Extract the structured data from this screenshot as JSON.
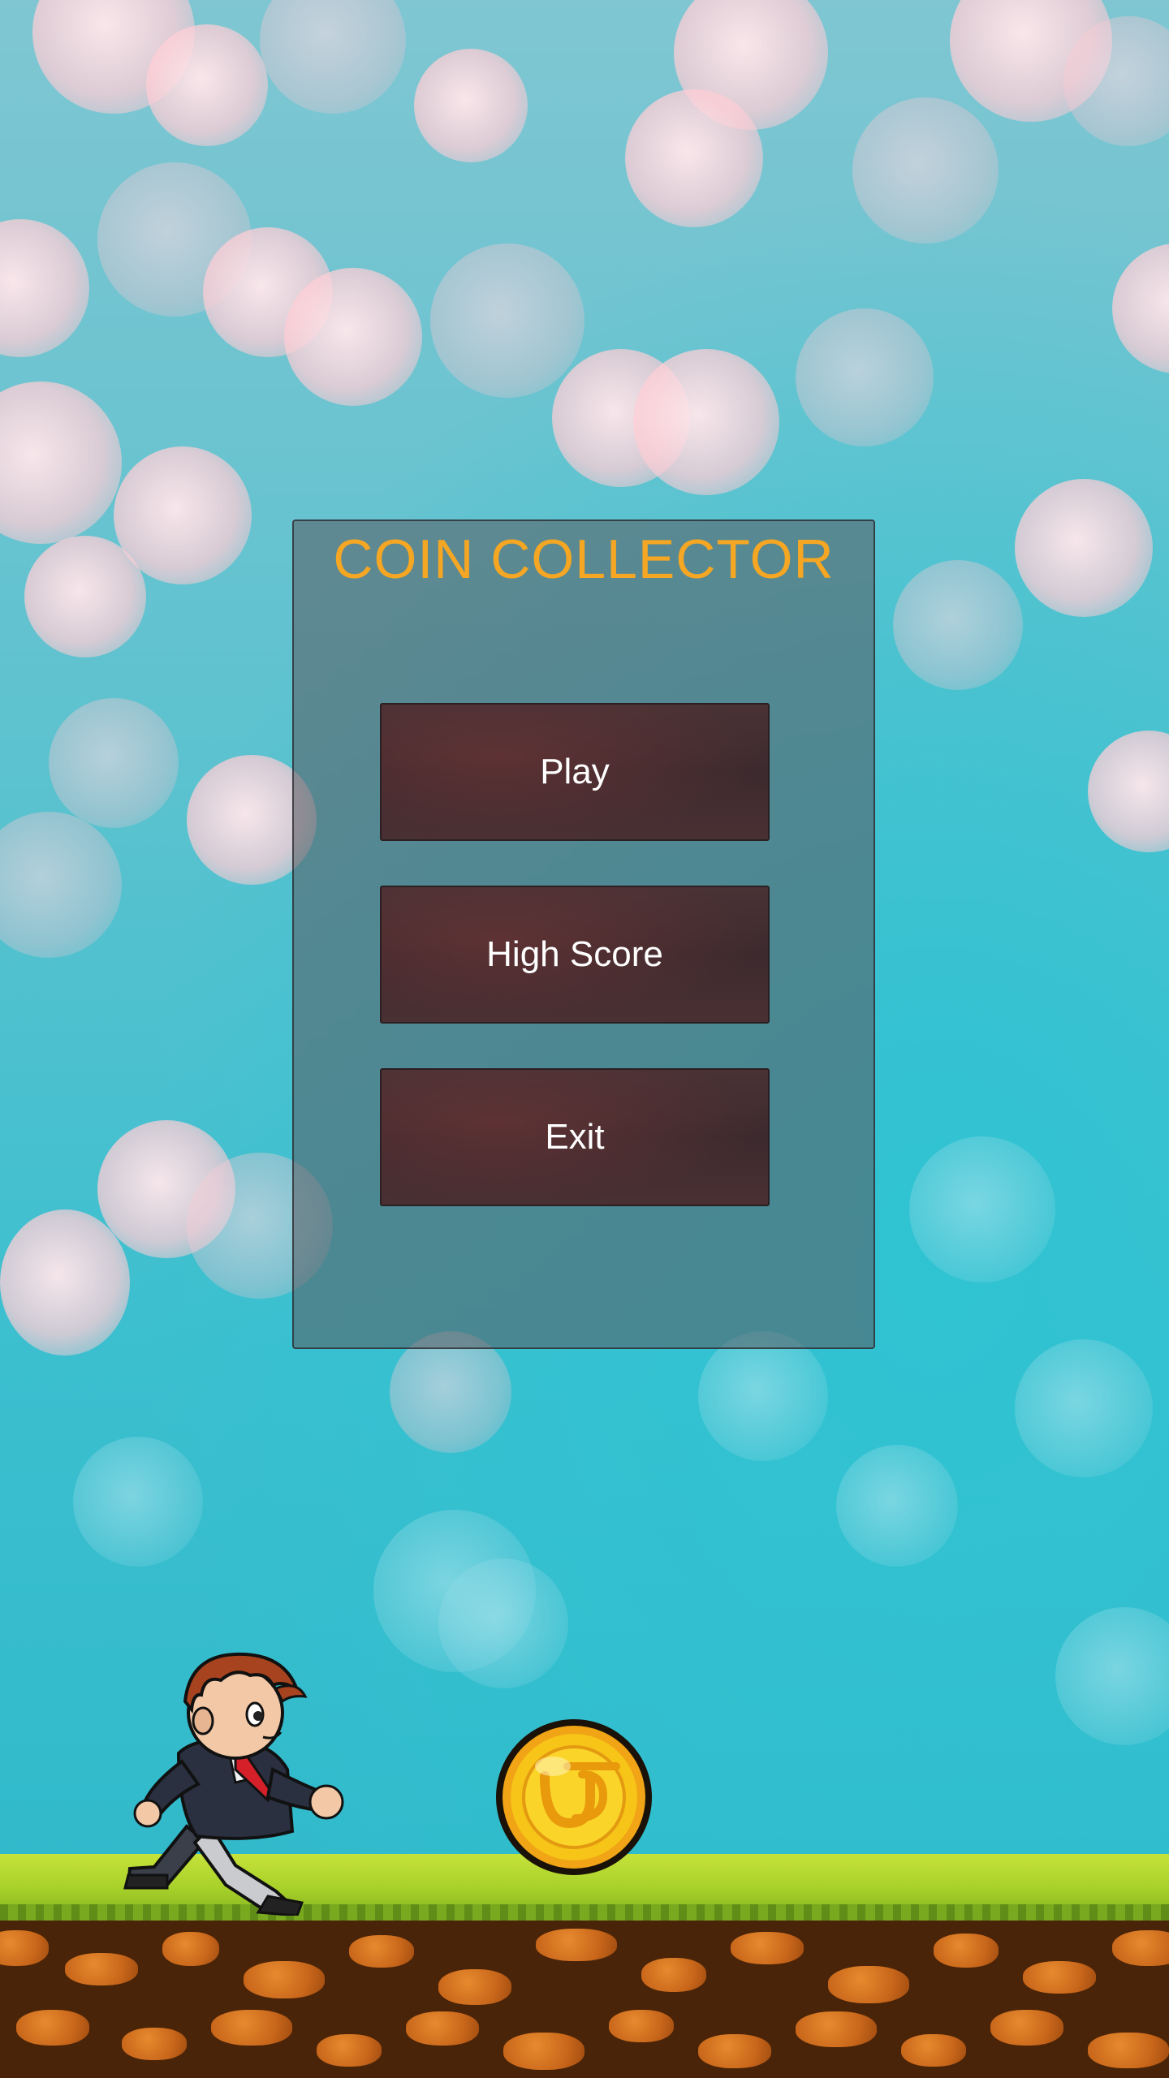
{
  "game": {
    "title": "COIN COLLECTOR"
  },
  "menu": {
    "play_label": "Play",
    "high_score_label": "High Score",
    "exit_label": "Exit"
  },
  "colors": {
    "title": "#f5a623",
    "button_text": "#ffffff",
    "sky": "#3bbfcf",
    "grass": "#a8d12a",
    "dirt": "#4a2408",
    "coin": "#f7c418"
  },
  "sprites": {
    "player": "running-boy-in-suit",
    "collectible": "gold-coin"
  }
}
